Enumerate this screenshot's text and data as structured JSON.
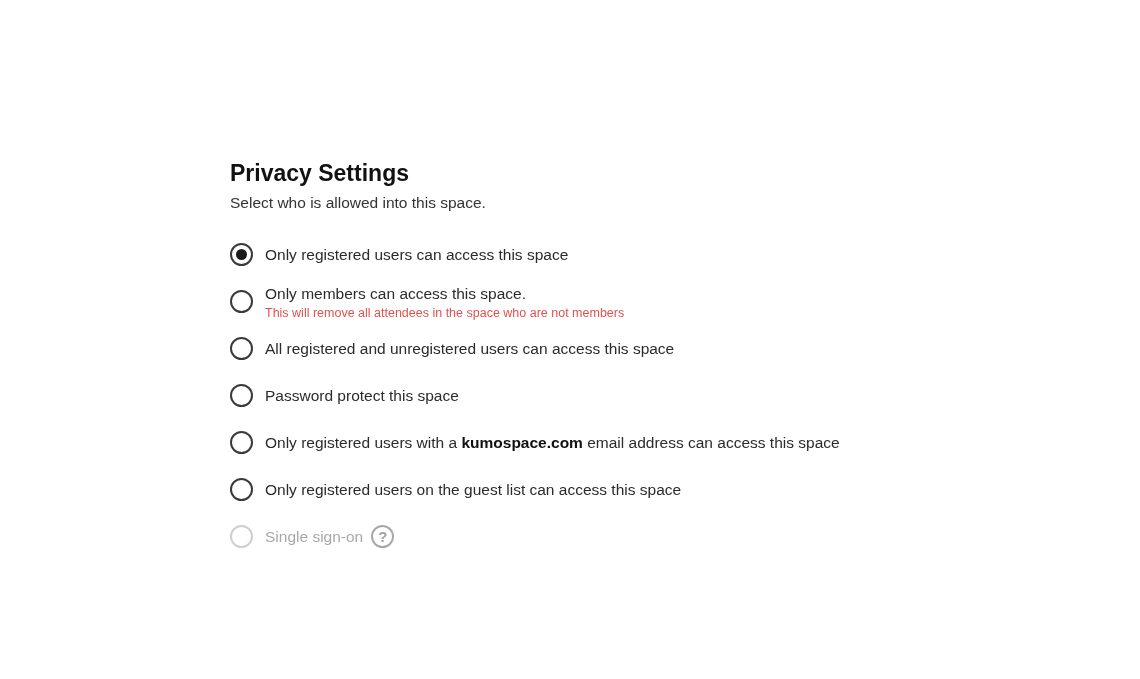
{
  "title": "Privacy Settings",
  "subtitle": "Select who is allowed into this space.",
  "options": [
    {
      "label": "Only registered users can access this space",
      "selected": true,
      "disabled": false
    },
    {
      "label": "Only members can access this space.",
      "warning": "This will remove all attendees in the space who are not members",
      "selected": false,
      "disabled": false
    },
    {
      "label": "All registered and unregistered users can access this space",
      "selected": false,
      "disabled": false
    },
    {
      "label": "Password protect this space",
      "selected": false,
      "disabled": false
    },
    {
      "label": "Only registered users with a **kumospace.com** email address can access this space",
      "selected": false,
      "disabled": false
    },
    {
      "label": "Only registered users on the guest list can access this space",
      "selected": false,
      "disabled": false
    },
    {
      "label": "Single sign-on",
      "help": "?",
      "selected": false,
      "disabled": true
    }
  ]
}
